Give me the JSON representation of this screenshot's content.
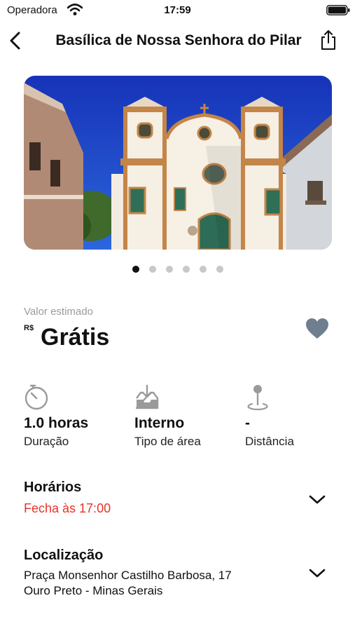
{
  "status_bar": {
    "carrier": "Operadora",
    "time": "17:59"
  },
  "header": {
    "title": "Basílica de Nossa Senhora do Pilar"
  },
  "gallery": {
    "page_count": 6,
    "active_index": 0
  },
  "price": {
    "label": "Valor estimado",
    "currency": "R$",
    "value": "Grátis"
  },
  "stats": [
    {
      "icon": "timer-icon",
      "value": "1.0 horas",
      "label": "Duração"
    },
    {
      "icon": "indoor-tray-icon",
      "value": "Interno",
      "label": "Tipo de área"
    },
    {
      "icon": "location-pin-icon",
      "value": "-",
      "label": "Distância"
    }
  ],
  "hours": {
    "title": "Horários",
    "status": "Fecha às 17:00",
    "status_color": "#e8322b"
  },
  "location": {
    "title": "Localização",
    "address_line1": "Praça Monsenhor Castilho Barbosa, 17",
    "address_line2": "Ouro Preto - Minas Gerais"
  },
  "colors": {
    "heart": "#6f7f90",
    "dot_active": "#111111",
    "dot_inactive": "#c8c8c8",
    "sky": "#1f47c9"
  }
}
